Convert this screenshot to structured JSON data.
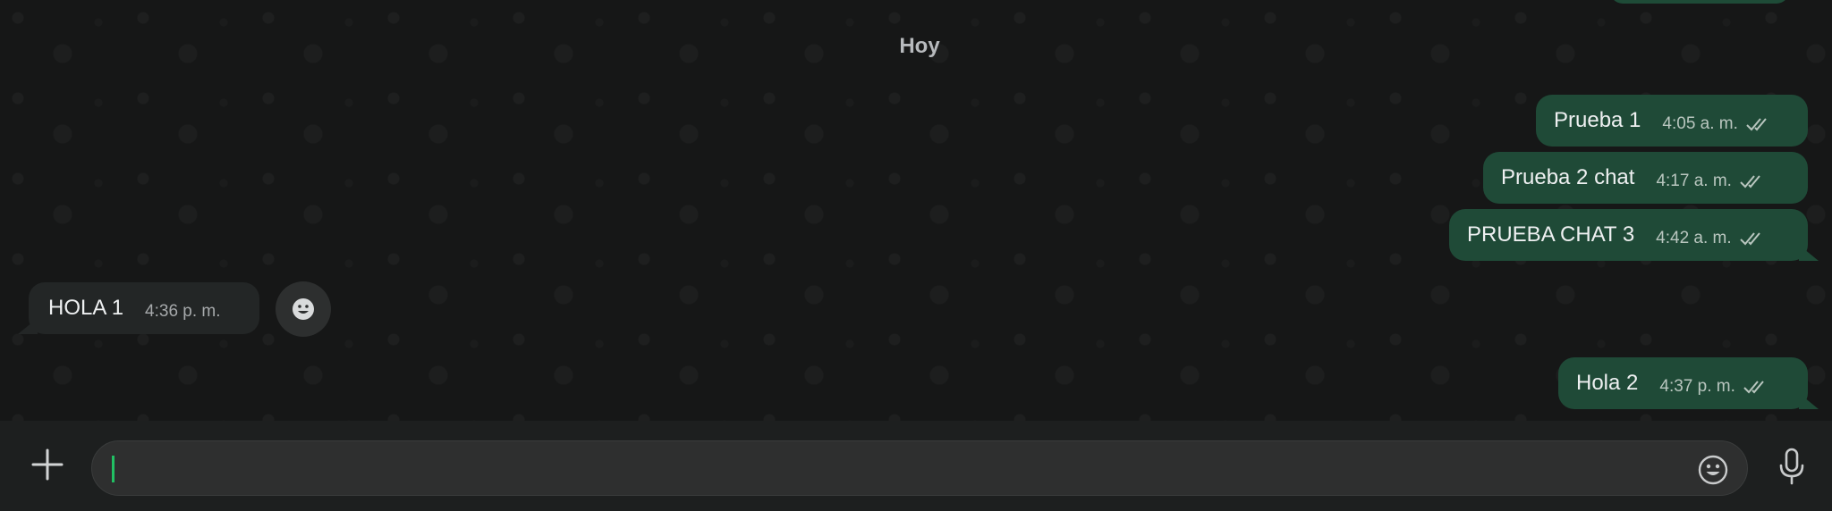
{
  "chat": {
    "date_label": "Hoy",
    "messages": [
      {
        "text": "Prueba 1",
        "time": "4:05 a. m.",
        "direction": "outgoing",
        "status": "read"
      },
      {
        "text": "Prueba 2 chat",
        "time": "4:17 a. m.",
        "direction": "outgoing",
        "status": "read"
      },
      {
        "text": "PRUEBA CHAT 3",
        "time": "4:42 a. m.",
        "direction": "outgoing",
        "status": "read"
      },
      {
        "text": "HOLA 1",
        "time": "4:36 p. m.",
        "direction": "incoming"
      },
      {
        "text": "Hola 2",
        "time": "4:37 p. m.",
        "direction": "outgoing",
        "status": "read"
      }
    ]
  },
  "composer": {
    "value": "",
    "placeholder": "",
    "icons": {
      "attach": "plus-icon",
      "emoji": "smiley-icon",
      "voice": "microphone-icon"
    }
  },
  "colors": {
    "outgoing_bubble": "#1f4a37",
    "incoming_bubble": "#232626",
    "background": "#161717",
    "accent": "#21c063"
  }
}
